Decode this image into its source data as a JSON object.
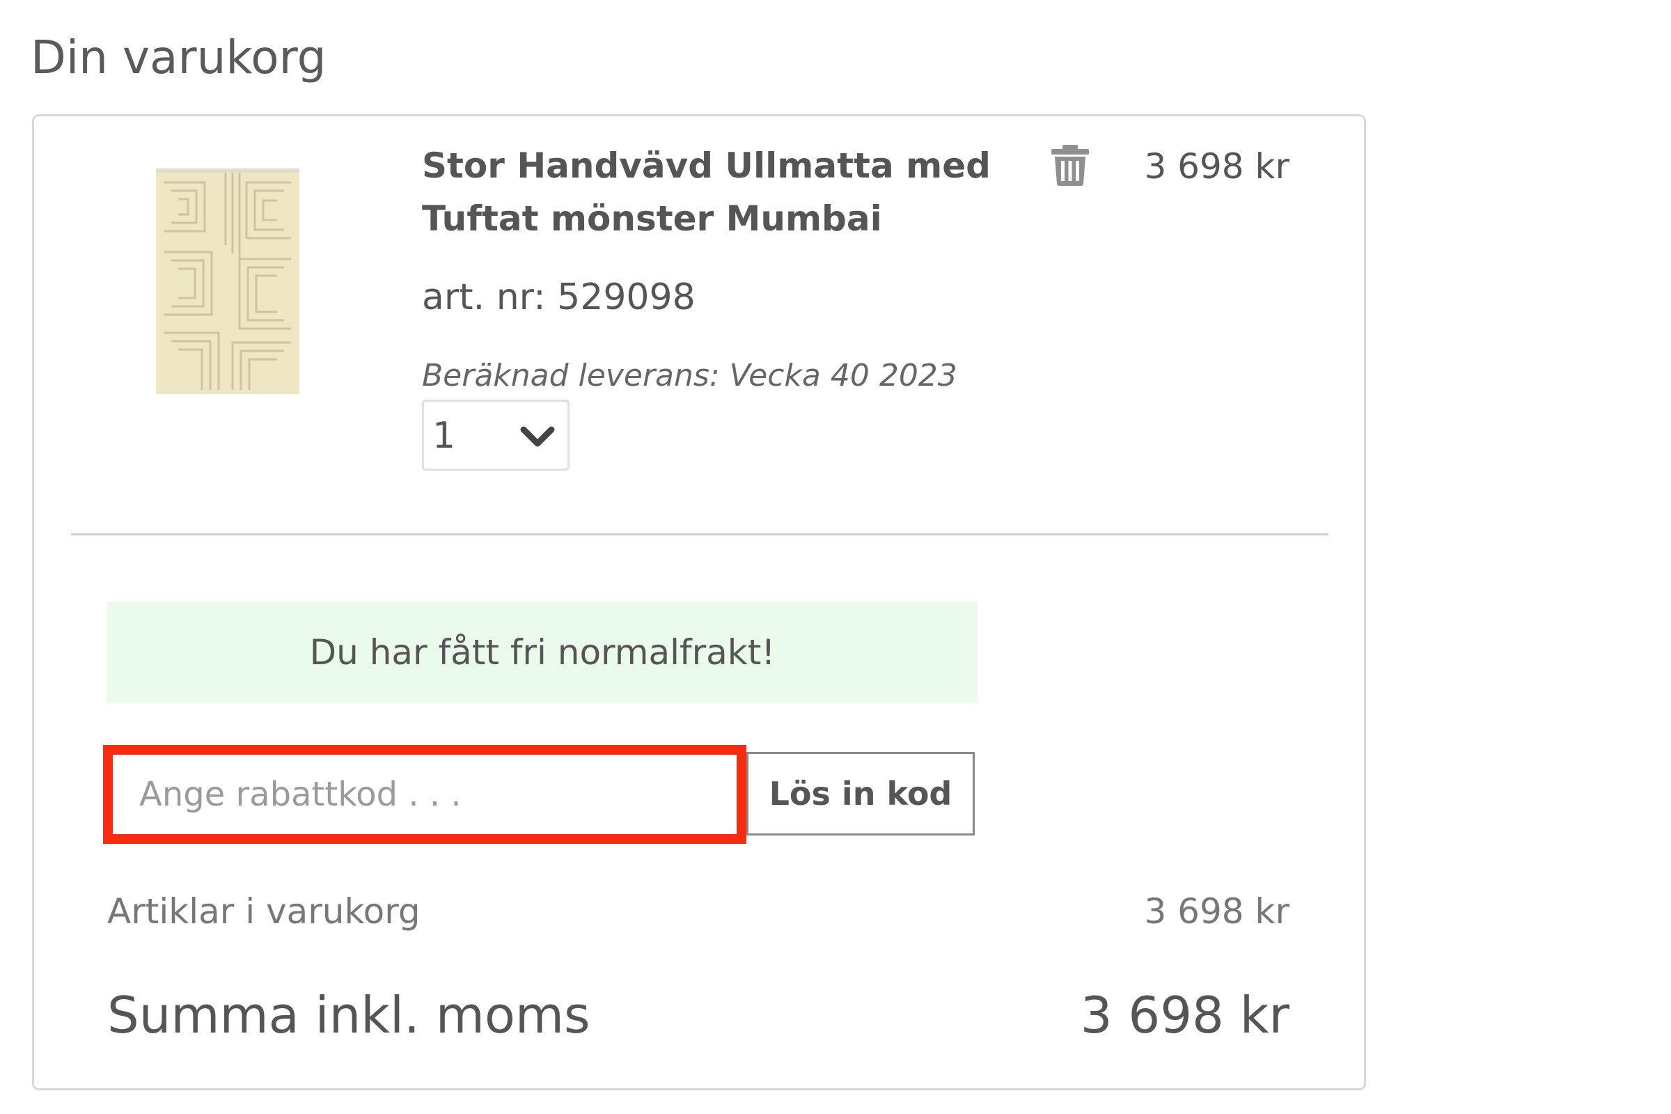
{
  "page": {
    "title": "Din varukorg"
  },
  "cart_item": {
    "name": "Stor Handvävd Ullmatta med Tuftat mönster Mumbai",
    "article_number": "art. nr: 529098",
    "delivery_estimate": "Beräknad leverans: Vecka 40 2023",
    "price": "3 698 kr",
    "quantity": "1",
    "image_icon": "rug-product-image",
    "remove_icon": "trash-icon"
  },
  "shipping_banner": {
    "text": "Du har fått fri normalfrakt!",
    "background_color": "#ebfbeb"
  },
  "discount": {
    "placeholder": "Ange rabattkod . . .",
    "value": "",
    "redeem_label": "Lös in kod",
    "highlight_color": "#f82a10"
  },
  "summary": {
    "subtotal_label": "Artiklar i varukorg",
    "subtotal_value": "3 698 kr",
    "total_label": "Summa inkl. moms",
    "total_value": "3 698 kr"
  }
}
